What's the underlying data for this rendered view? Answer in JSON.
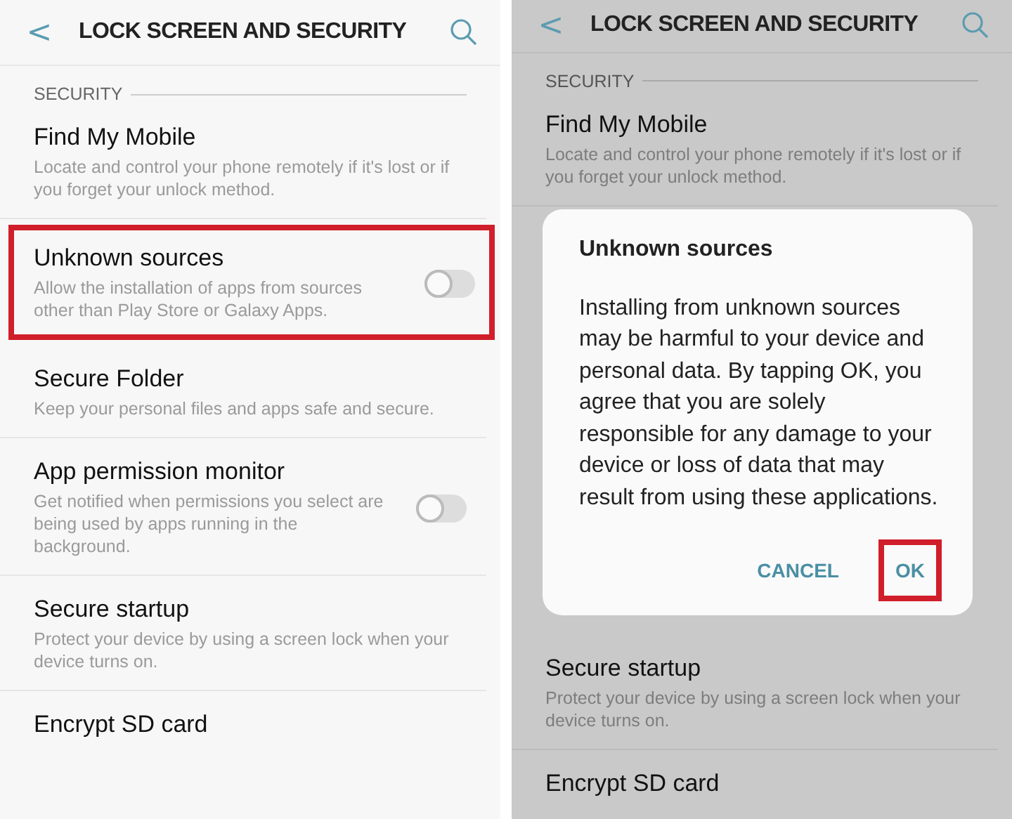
{
  "screens": [
    {
      "dimmed": false,
      "header": {
        "back": "<",
        "title": "LOCK SCREEN AND SECURITY"
      },
      "section": "SECURITY",
      "items": [
        {
          "kind": "setting",
          "title": "Find My Mobile",
          "description": "Locate and control your phone remotely if it's lost or if you forget your unlock method.",
          "highlighted": false
        },
        {
          "kind": "toggle",
          "title": "Unknown sources",
          "description": "Allow the installation of apps from sources other than Play Store or Galaxy Apps.",
          "on": false,
          "highlighted": true
        },
        {
          "kind": "setting",
          "title": "Secure Folder",
          "description": "Keep your personal files and apps safe and secure.",
          "highlighted": false
        },
        {
          "kind": "toggle",
          "title": "App permission monitor",
          "description": "Get notified when permissions you select are being used by apps running in the background.",
          "on": false,
          "highlighted": false
        },
        {
          "kind": "setting",
          "title": "Secure startup",
          "description": "Protect your device by using a screen lock when your device turns on.",
          "highlighted": false
        },
        {
          "kind": "setting",
          "title": "Encrypt SD card",
          "highlighted": false
        }
      ]
    },
    {
      "dimmed": true,
      "header": {
        "back": "<",
        "title": "LOCK SCREEN AND SECURITY"
      },
      "section": "SECURITY",
      "items": [
        {
          "kind": "setting",
          "title": "Find My Mobile",
          "description": "Locate and control your phone remotely if it's lost or if you forget your unlock method.",
          "highlighted": false
        },
        {
          "kind": "dialog",
          "title": "Unknown sources",
          "message": "Installing from unknown sources may be harmful to your device and personal data. By tapping OK, you agree that you are solely responsible for any damage to your device or loss of data that may result from using these applications.",
          "buttons": [
            {
              "label": "CANCEL",
              "highlighted": false
            },
            {
              "label": "OK",
              "highlighted": true
            }
          ]
        },
        {
          "kind": "setting",
          "title": "Secure startup",
          "description": "Protect your device by using a screen lock when your device turns on.",
          "highlighted": false
        },
        {
          "kind": "setting",
          "title": "Encrypt SD card",
          "highlighted": false
        }
      ]
    }
  ]
}
